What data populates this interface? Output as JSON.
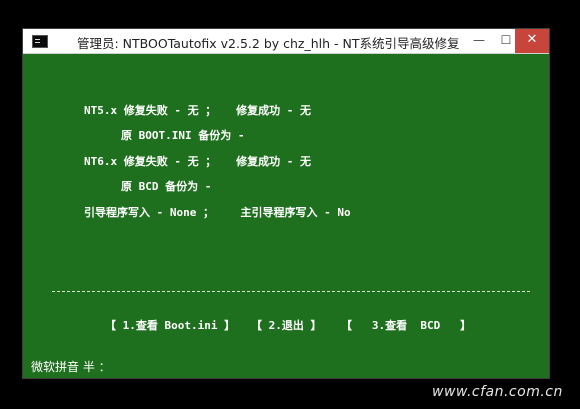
{
  "window": {
    "title": "管理员:  NTBOOTautofix v2.5.2 by chz_hlh - NT系统引导高级修复",
    "controls": {
      "minimize": "—",
      "maximize": "☐",
      "close": "✕"
    }
  },
  "console": {
    "nt5_status": "NT5.x 修复失败 - 无 ；   修复成功 - 无",
    "nt5_backup": "原 BOOT.INI 备份为 -",
    "nt6_status": "NT6.x 修复失败 - 无 ；   修复成功 - 无",
    "nt6_backup": "原 BCD 备份为 -",
    "boot_write": "引导程序写入 - None ；    主引导程序写入 - No"
  },
  "menu": {
    "option1": "【 1.查看 Boot.ini 】",
    "option2": "【 2.退出 】",
    "option3": "【   3.查看  BCD   】"
  },
  "statusbar": {
    "ime": "微软拼音 半 ："
  },
  "watermark": "www.cfan.com.cn",
  "colors": {
    "console_bg": "#1e6f1e",
    "close_button": "#c7453b"
  }
}
